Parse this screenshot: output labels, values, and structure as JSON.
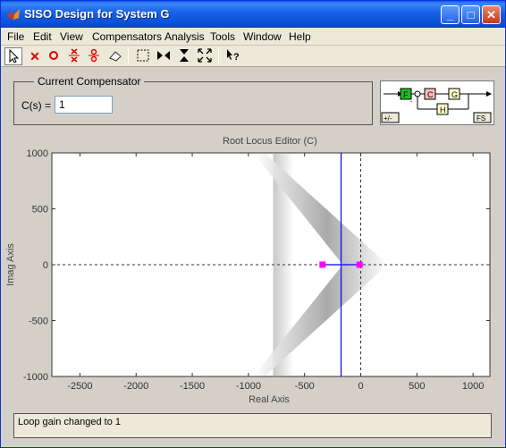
{
  "window": {
    "title": "SISO Design for System G"
  },
  "menu": [
    "File",
    "Edit",
    "View",
    "Compensators",
    "Analysis",
    "Tools",
    "Window",
    "Help"
  ],
  "toolbar_icons": [
    "pointer-icon",
    "add-pole-icon",
    "add-zero-icon",
    "add-complex-pole-icon",
    "add-complex-zero-icon",
    "eraser-icon",
    "zoom-region-icon",
    "zoom-x-icon",
    "zoom-y-icon",
    "fit-icon",
    "whats-this-icon"
  ],
  "compensator": {
    "legend": "Current Compensator",
    "label": "C(s) =",
    "value": "1"
  },
  "architecture": {
    "blocks": [
      "F",
      "C",
      "G",
      "H"
    ],
    "sign_button": "+/-",
    "fs_button": "FS"
  },
  "editor": {
    "title": "Root Locus Editor (C)",
    "xlabel": "Real Axis",
    "ylabel": "Imag Axis",
    "xticks": [
      "-2500",
      "-2000",
      "-1500",
      "-1000",
      "-500",
      "0",
      "500",
      "1000"
    ],
    "yticks": [
      "1000",
      "500",
      "0",
      "-500",
      "-1000"
    ]
  },
  "chart_data": {
    "type": "scatter",
    "title": "Root Locus Editor (C)",
    "xlabel": "Real Axis",
    "ylabel": "Imag Axis",
    "xlim": [
      -2750,
      1150
    ],
    "ylim": [
      -1000,
      1000
    ],
    "poles": [
      {
        "x": -340,
        "y": 0
      },
      {
        "x": -10,
        "y": 0
      }
    ],
    "closed_loop_line_x": -175,
    "asymptote_vertex": {
      "x": 0,
      "y": 0
    },
    "colors": {
      "poles": "#ff00ff",
      "cl_line": "#0000ff"
    }
  },
  "status": {
    "text": "Loop gain changed to 1"
  }
}
